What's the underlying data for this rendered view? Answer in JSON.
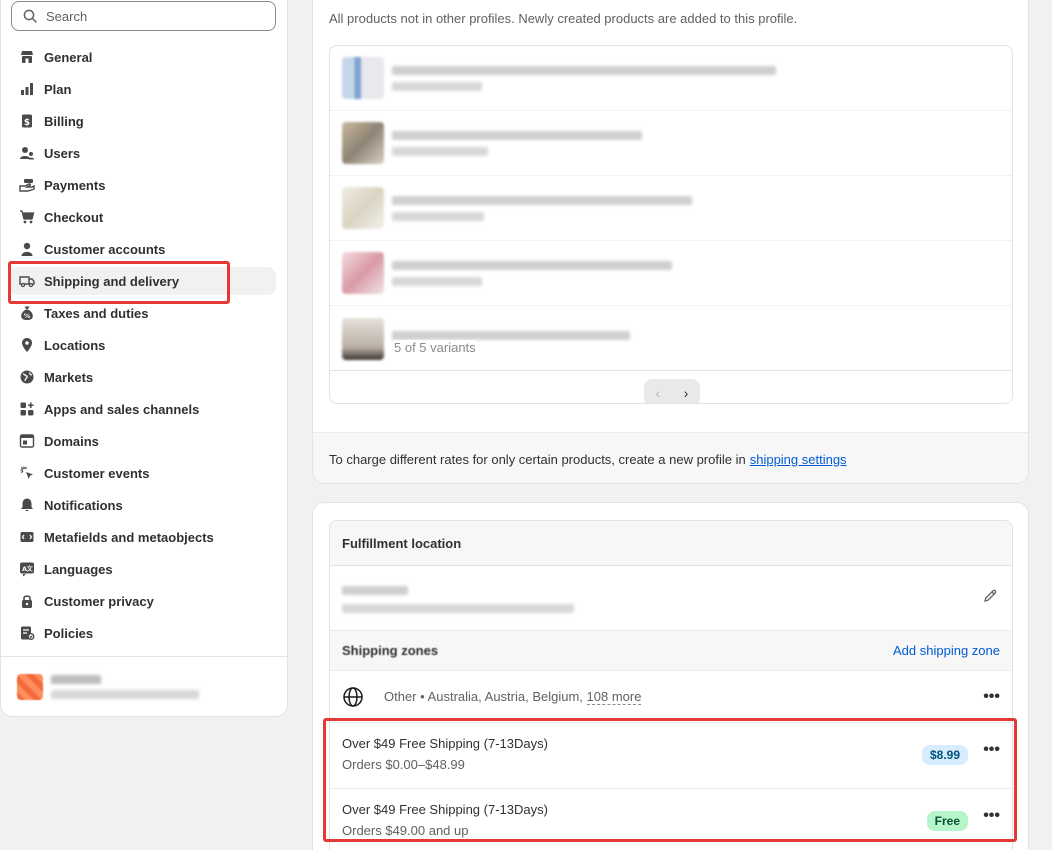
{
  "search": {
    "placeholder": "Search"
  },
  "nav": [
    {
      "label": "General",
      "icon": "store-icon"
    },
    {
      "label": "Plan",
      "icon": "plan-chart-icon"
    },
    {
      "label": "Billing",
      "icon": "receipt-dollar-icon"
    },
    {
      "label": "Users",
      "icon": "users-icon"
    },
    {
      "label": "Payments",
      "icon": "payment-hand-icon"
    },
    {
      "label": "Checkout",
      "icon": "cart-icon"
    },
    {
      "label": "Customer accounts",
      "icon": "person-icon"
    },
    {
      "label": "Shipping and delivery",
      "icon": "truck-icon"
    },
    {
      "label": "Taxes and duties",
      "icon": "money-bag-icon"
    },
    {
      "label": "Locations",
      "icon": "location-pin-icon"
    },
    {
      "label": "Markets",
      "icon": "globe-markets-icon"
    },
    {
      "label": "Apps and sales channels",
      "icon": "apps-icon"
    },
    {
      "label": "Domains",
      "icon": "domain-icon"
    },
    {
      "label": "Customer events",
      "icon": "cursor-click-icon"
    },
    {
      "label": "Notifications",
      "icon": "bell-icon"
    },
    {
      "label": "Metafields and metaobjects",
      "icon": "metafields-icon"
    },
    {
      "label": "Languages",
      "icon": "language-icon"
    },
    {
      "label": "Customer privacy",
      "icon": "lock-icon"
    },
    {
      "label": "Policies",
      "icon": "policy-icon"
    }
  ],
  "active_nav": "Shipping and delivery",
  "products": {
    "description": "All products not in other profiles. Newly created products are added to this profile.",
    "variants_text": "5 of 5 variants",
    "footer_text": "To charge different rates for only certain products, create a new profile in",
    "footer_link": "shipping settings"
  },
  "fulfillment": {
    "heading": "Fulfillment location",
    "zones_title": "Shipping zones",
    "add_zone": "Add shipping zone",
    "zone": {
      "prefix": "Other • Australia, Austria, Belgium,",
      "more": "108 more"
    },
    "rates": [
      {
        "name": "Over $49 Free Shipping (7-13Days)",
        "condition": "Orders $0.00–$48.99",
        "price": "$8.99",
        "badge_color": "#d8ecff"
      },
      {
        "name": "Over $49 Free Shipping (7-13Days)",
        "condition": "Orders $49.00 and up",
        "price": "Free",
        "badge_color": "#b6f5c9"
      }
    ]
  },
  "colors": {
    "link": "#005bd3",
    "highlight": "#e53935"
  }
}
